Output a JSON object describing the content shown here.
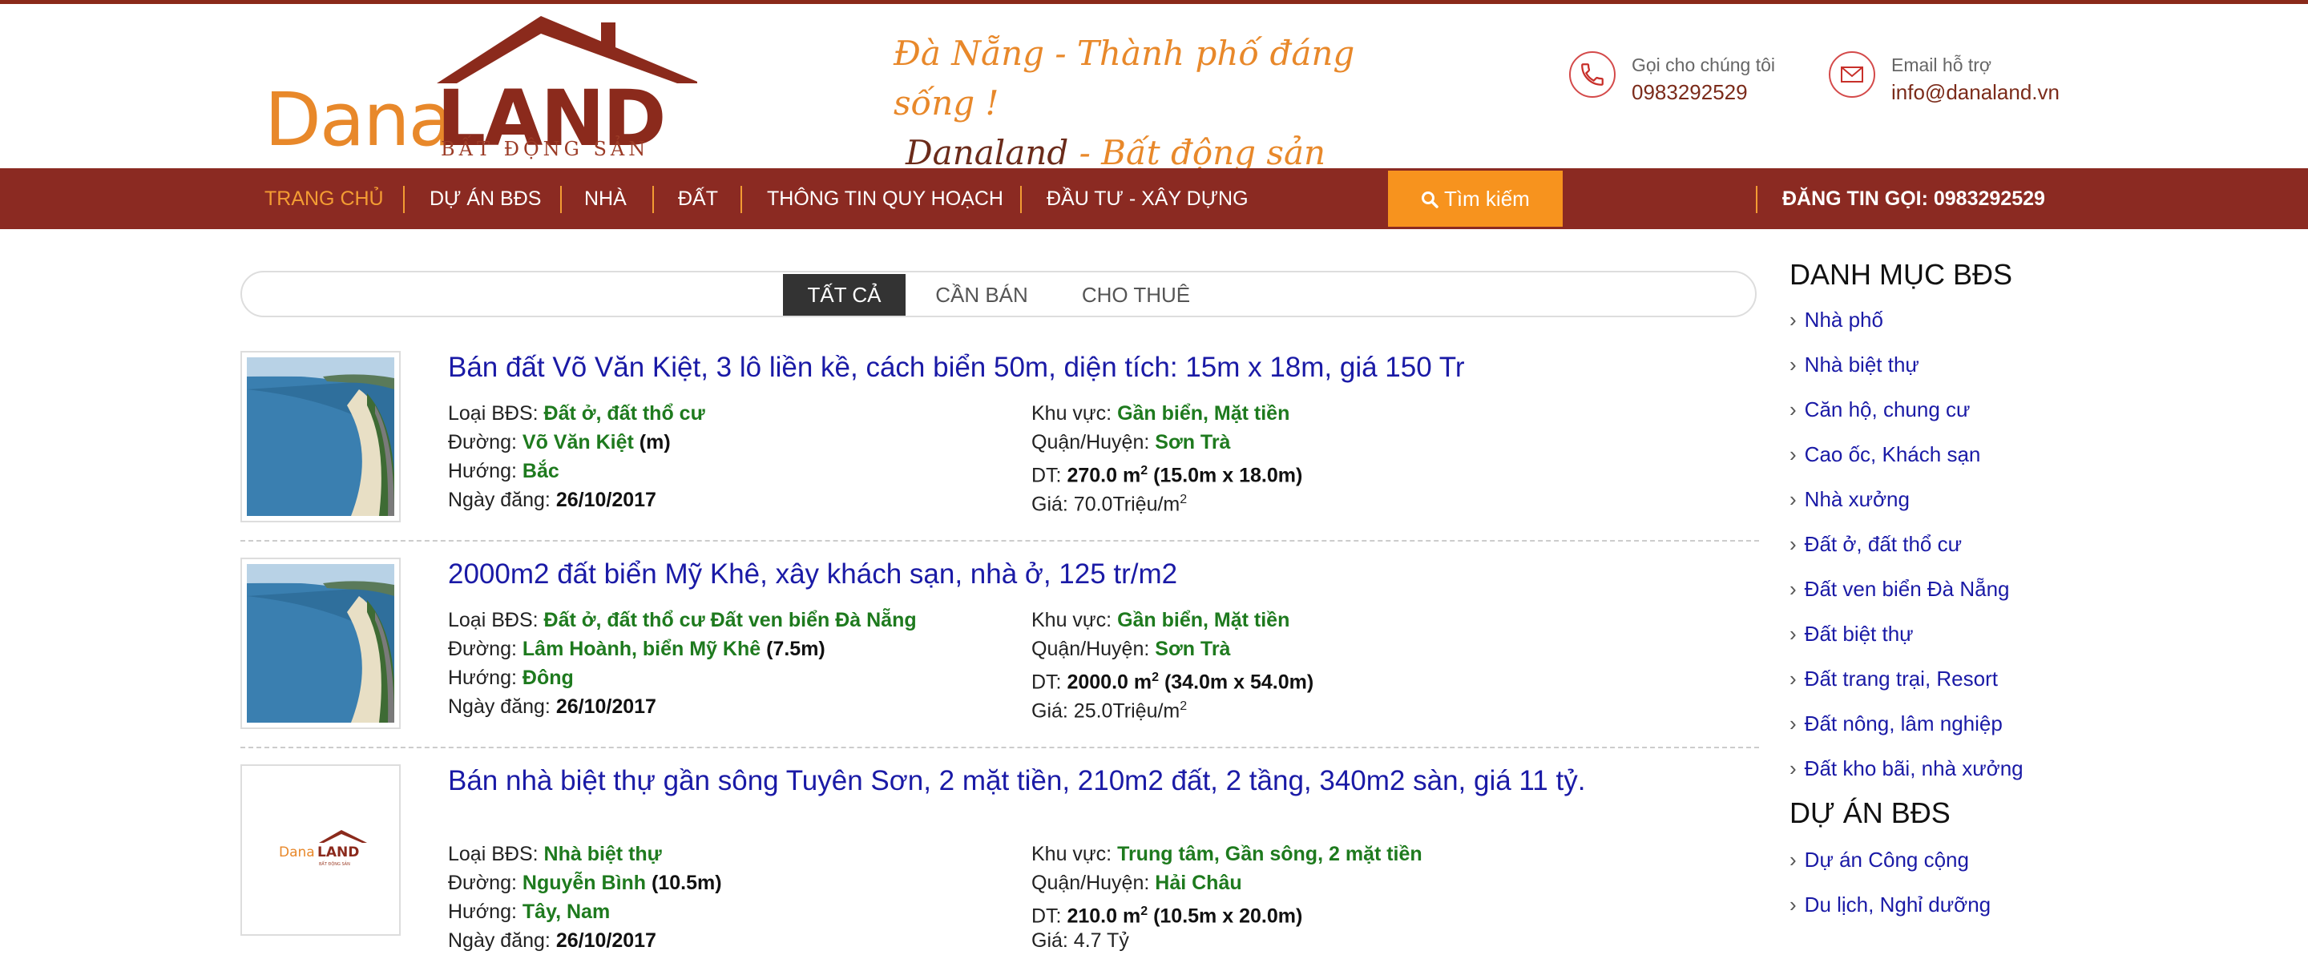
{
  "header": {
    "logo": {
      "part1": "Dana",
      "part2": "LAND",
      "subtitle": "BẤT ĐỘNG SẢN"
    },
    "slogan": {
      "line1": "Đà Nẵng - Thành phố đáng sống !",
      "line2a": "Danaland",
      "line2b": " - Bất động sản đáng giá !"
    },
    "phone": {
      "label": "Gọi cho chúng tôi",
      "value": "0983292529",
      "icon": "phone-icon"
    },
    "email": {
      "label": "Email hỗ trợ",
      "value": "info@danaland.vn",
      "icon": "envelope-icon"
    }
  },
  "nav": {
    "items": [
      "TRANG CHỦ",
      "DỰ ÁN BĐS",
      "NHÀ",
      "ĐẤT",
      "THÔNG TIN QUY HOẠCH",
      "ĐẦU TƯ - XÂY DỰNG"
    ],
    "active": 0,
    "search_label": "Tìm kiếm",
    "hotline": "ĐĂNG TIN GỌI: 0983292529"
  },
  "tabs": {
    "items": [
      "TẤT CẢ",
      "CẦN BÁN",
      "CHO THUÊ"
    ],
    "active": 0
  },
  "labels": {
    "type": "Loại BĐS: ",
    "street": "Đường: ",
    "direction": "Hướng: ",
    "date": "Ngày đăng: ",
    "area_region": "Khu vực: ",
    "district": "Quận/Huyện: ",
    "size": "DT: ",
    "price": "Giá: "
  },
  "listings": [
    {
      "title": "Bán đất Võ Văn Kiệt, 3 lô liền kề, cách biển 50m, diện tích: 15m x 18m, giá 150 Tr",
      "type": "Đất ở, đất thổ cư",
      "street": "Võ Văn Kiệt",
      "street_width": "(m)",
      "direction": "Bắc",
      "date": "26/10/2017",
      "region": "Gần biển, Mặt tiền",
      "district": "Sơn Trà",
      "area": "270.0 m",
      "dimensions": "(15.0m x 18.0m)",
      "price": "70.0Triệu/m",
      "image": "beach"
    },
    {
      "title": "2000m2 đất biển Mỹ Khê, xây khách sạn, nhà ở, 125 tr/m2",
      "type": "Đất ở, đất thổ cư Đất ven biển Đà Nẵng",
      "street": "Lâm Hoành, biển Mỹ Khê",
      "street_width": "(7.5m)",
      "direction": "Đông",
      "date": "26/10/2017",
      "region": "Gần biển, Mặt tiền",
      "district": "Sơn Trà",
      "area": "2000.0 m",
      "dimensions": "(34.0m x 54.0m)",
      "price": "25.0Triệu/m",
      "image": "beach"
    },
    {
      "title": "Bán nhà biệt thự gần sông Tuyên Sơn, 2 mặt tiền, 210m2 đất, 2 tầng, 340m2 sàn, giá 11 tỷ.",
      "type": "Nhà biệt thự",
      "street": "Nguyễn Bình",
      "street_width": "(10.5m)",
      "direction": "Tây, Nam",
      "date": "26/10/2017",
      "region": "Trung tâm, Gần sông, 2 mặt tiền",
      "district": "Hải Châu",
      "area": "210.0 m",
      "dimensions": "(10.5m x 20.0m)",
      "price": "4.7 Tỷ",
      "image": "logo"
    }
  ],
  "sidebar": {
    "categories_title": "DANH MỤC BĐS",
    "categories": [
      "Nhà phố",
      "Nhà biệt thự",
      "Căn hộ, chung cư",
      "Cao ốc, Khách sạn",
      "Nhà xưởng",
      "Đất ở, đất thổ cư",
      "Đất ven biển Đà Nẵng",
      "Đất biệt thự",
      "Đất trang trại, Resort",
      "Đất nông, lâm nghiệp",
      "Đất kho bãi, nhà xưởng"
    ],
    "projects_title": "DỰ ÁN BĐS",
    "projects": [
      "Dự án Công cộng",
      "Du lịch, Nghỉ dưỡng"
    ]
  },
  "colors": {
    "nav_bg": "#8b2a22",
    "accent": "#f7931e",
    "link": "#1a1aa6",
    "value_green": "#1e7a1e"
  }
}
